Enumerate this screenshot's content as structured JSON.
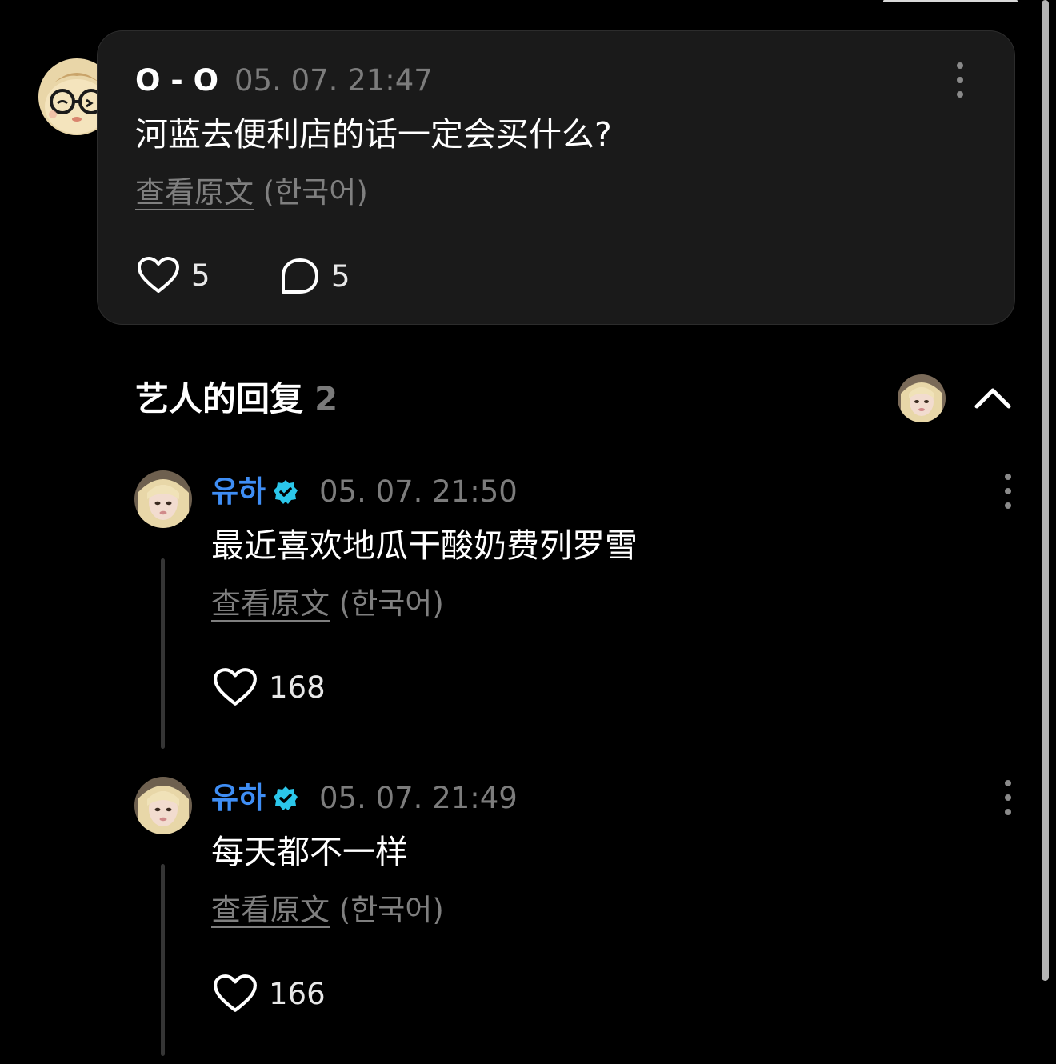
{
  "post": {
    "author": "O - O",
    "timestamp": "05. 07. 21:47",
    "text": "河蓝去便利店的话一定会买什么?",
    "translate_link": "查看原文",
    "translate_lang": "(한국어)",
    "likes": "5",
    "comments": "5",
    "icons": {
      "like": "heart-icon",
      "comment": "comment-bubble-icon",
      "more": "more-vertical-icon"
    }
  },
  "artist_replies": {
    "title": "艺人的回复",
    "count": "2",
    "collapse_icon": "chevron-up-icon"
  },
  "replies": [
    {
      "author": "유하",
      "timestamp": "05. 07. 21:50",
      "text": "最近喜欢地瓜干酸奶费列罗雪",
      "translate_link": "查看原文",
      "translate_lang": "(한국어)",
      "likes": "168"
    },
    {
      "author": "유하",
      "timestamp": "05. 07. 21:49",
      "text": "每天都不一样",
      "translate_link": "查看原文",
      "translate_lang": "(한국어)",
      "likes": "166"
    }
  ],
  "colors": {
    "background": "#000000",
    "card": "#1a1a1a",
    "artist_name": "#3f8ef5",
    "verified_badge": "#2bc6ea",
    "muted_text": "#7c7c7c"
  }
}
